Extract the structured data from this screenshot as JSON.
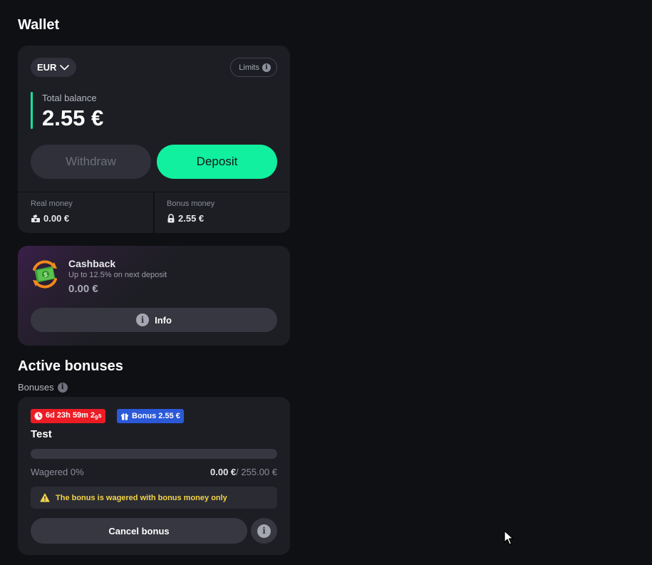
{
  "wallet": {
    "title": "Wallet",
    "currency": "EUR",
    "limits_label": "Limits",
    "total_balance_label": "Total balance",
    "total_balance_value": "2.55 €",
    "withdraw_label": "Withdraw",
    "deposit_label": "Deposit",
    "real_money_label": "Real money",
    "real_money_value": "0.00 €",
    "bonus_money_label": "Bonus money",
    "bonus_money_value": "2.55 €"
  },
  "cashback": {
    "title": "Cashback",
    "subtitle": "Up to 12.5% on next deposit",
    "value": "0.00 €",
    "info_label": "Info"
  },
  "active_bonuses": {
    "title": "Active bonuses",
    "bonuses_label": "Bonuses",
    "bonus": {
      "timer": {
        "days": "6d",
        "hours": "23h",
        "minutes": "59m",
        "seconds_major": "2",
        "seconds_minor": "9",
        "seconds_unit": "s"
      },
      "badge_label": "Bonus 2.55 €",
      "name": "Test",
      "progress_fraction": 0,
      "wagered_label": "Wagered 0%",
      "wagered_current": "0.00 €",
      "wagered_total": "/ 255.00 €",
      "warning": "The bonus is wagered with bonus money only",
      "cancel_label": "Cancel bonus"
    }
  },
  "colors": {
    "accent_green": "#10f09f",
    "timer_red": "#ec1c24",
    "bonus_blue": "#2b59d8",
    "warning_yellow": "#f5d44a"
  }
}
